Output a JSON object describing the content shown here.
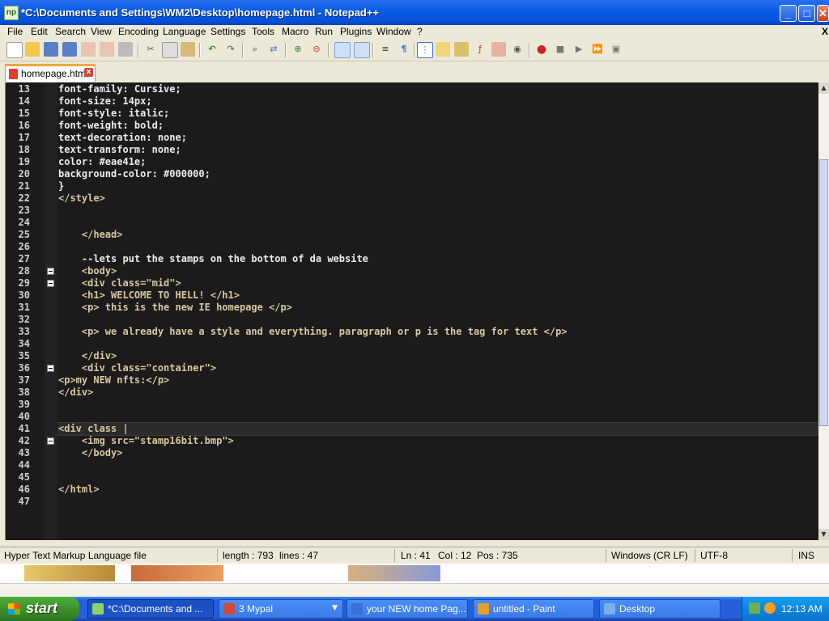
{
  "window": {
    "title": "*C:\\Documents and Settings\\WM2\\Desktop\\homepage.html - Notepad++",
    "app_icon_text": "np",
    "controls": {
      "minimize": "_",
      "maximize": "□",
      "close": "✕"
    }
  },
  "menu": [
    "File",
    "Edit",
    "Search",
    "View",
    "Encoding",
    "Language",
    "Settings",
    "Tools",
    "Macro",
    "Run",
    "Plugins",
    "Window",
    "?"
  ],
  "menu_close": "X",
  "toolbar": {
    "icons": [
      "new-file-icon",
      "open-file-icon",
      "save-icon",
      "save-all-icon",
      "close-file-icon",
      "close-all-icon",
      "print-icon",
      "cut-icon",
      "copy-icon",
      "paste-icon",
      "undo-icon",
      "redo-icon",
      "find-icon",
      "replace-icon",
      "zoom-in-icon",
      "zoom-out-icon",
      "sync-vertical-icon",
      "sync-horizontal-icon",
      "word-wrap-icon",
      "show-all-chars-icon",
      "indent-guide-icon",
      "user-language-icon",
      "doc-map-icon",
      "function-list-icon",
      "folder-workspace-icon",
      "monitor-icon",
      "record-macro-icon",
      "stop-macro-icon",
      "play-macro-icon",
      "run-macro-multiple-icon",
      "save-macro-icon"
    ]
  },
  "tabs": [
    {
      "label": "homepage.html",
      "close": "x",
      "modified": true
    }
  ],
  "editor": {
    "lines": [
      {
        "n": "13",
        "text": "font-family: Cursive;",
        "indent": 0
      },
      {
        "n": "14",
        "text": "font-size: 14px;",
        "indent": 0
      },
      {
        "n": "15",
        "text": "font-style: italic;",
        "indent": 0
      },
      {
        "n": "16",
        "text": "font-weight: bold;",
        "indent": 0
      },
      {
        "n": "17",
        "text": "text-decoration: none;",
        "indent": 0
      },
      {
        "n": "18",
        "text": "text-transform: none;",
        "indent": 0
      },
      {
        "n": "19",
        "text": "color: #eae41e;",
        "indent": 0
      },
      {
        "n": "20",
        "text": "background-color: #000000;",
        "indent": 0
      },
      {
        "n": "21",
        "text": "}",
        "indent": 0
      },
      {
        "n": "22",
        "text": "</style>",
        "indent": 0
      },
      {
        "n": "23",
        "text": "",
        "indent": 0
      },
      {
        "n": "24",
        "text": "",
        "indent": 0
      },
      {
        "n": "25",
        "text": "    </head>",
        "indent": 0
      },
      {
        "n": "26",
        "text": "",
        "indent": 0
      },
      {
        "n": "27",
        "text": "    --lets put the stamps on the bottom of da website",
        "indent": 0
      },
      {
        "n": "28",
        "text": "    <body>",
        "indent": 0,
        "fold": true
      },
      {
        "n": "29",
        "text": "    <div class=\"mid\">",
        "indent": 0,
        "fold": true
      },
      {
        "n": "30",
        "text": "    <h1> WELCOME TO HELL! </h1>",
        "indent": 0
      },
      {
        "n": "31",
        "text": "    <p> this is the new IE homepage </p>",
        "indent": 0
      },
      {
        "n": "32",
        "text": "",
        "indent": 0
      },
      {
        "n": "33",
        "text": "    <p> we already have a style and everything. paragraph or p is the tag for text </p>",
        "indent": 0
      },
      {
        "n": "34",
        "text": "",
        "indent": 0
      },
      {
        "n": "35",
        "text": "    </div>",
        "indent": 0
      },
      {
        "n": "36",
        "text": "    <div class=\"container\">",
        "indent": 0,
        "fold": true
      },
      {
        "n": "37",
        "text": "<p>my NEW nfts:</p>",
        "indent": 0
      },
      {
        "n": "38",
        "text": "</div>",
        "indent": 0
      },
      {
        "n": "39",
        "text": "",
        "indent": 0
      },
      {
        "n": "40",
        "text": "",
        "indent": 0
      },
      {
        "n": "41",
        "text": "<div class |",
        "indent": 0,
        "current": true
      },
      {
        "n": "42",
        "text": "    <img src=\"stamp16bit.bmp\">",
        "indent": 0,
        "fold": true
      },
      {
        "n": "43",
        "text": "    </body>",
        "indent": 0
      },
      {
        "n": "44",
        "text": "",
        "indent": 0
      },
      {
        "n": "45",
        "text": "",
        "indent": 0
      },
      {
        "n": "46",
        "text": "</html>",
        "indent": 0
      },
      {
        "n": "47",
        "text": "",
        "indent": 0
      }
    ]
  },
  "statusbar": {
    "file_type": "Hyper Text Markup Language file",
    "length": "length : 793",
    "lines": "lines : 47",
    "ln": "Ln : 41",
    "col": "Col : 12",
    "pos": "Pos : 735",
    "eol": "Windows (CR LF)",
    "encoding": "UTF-8",
    "mode": "INS"
  },
  "taskbar": {
    "start_label": "start",
    "buttons": [
      {
        "label": "*C:\\Documents and ...",
        "active": true,
        "color": "#8fd16b"
      },
      {
        "label": "3 Mypal",
        "active": false,
        "color": "#d24a3a"
      },
      {
        "label": "your NEW home Pag...",
        "active": false,
        "color": "#3a6fd8"
      },
      {
        "label": "untitled - Paint",
        "active": false,
        "color": "#e0a030"
      },
      {
        "label": "Desktop",
        "active": false,
        "color": "#7ab0e8"
      }
    ],
    "clock": "12:13 AM"
  },
  "colors": {
    "editor_bg": "#1b1b1b",
    "tag_color": "#b8a078",
    "string_color": "#b3d39b",
    "title_bar": "#0a5de8"
  }
}
